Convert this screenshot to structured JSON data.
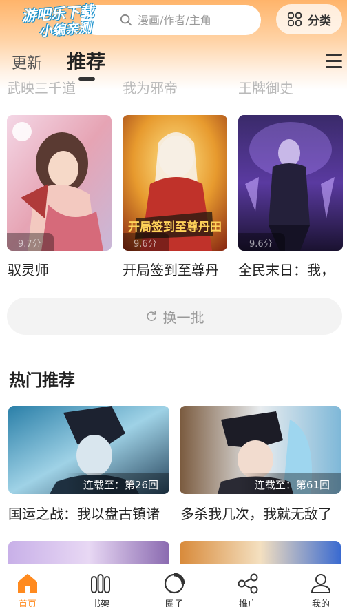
{
  "header": {
    "watermark_line1": "游吧乐下载",
    "watermark_line2": "小编亲测",
    "search_placeholder": "漫画/作者/主角",
    "category_label": "分类"
  },
  "tabs": [
    {
      "label": "更新",
      "active": false
    },
    {
      "label": "推荐",
      "active": true
    }
  ],
  "previous_row_titles": [
    "武映三千道",
    "我为邪帝",
    "王牌御史"
  ],
  "recommend_cards": [
    {
      "title": "驭灵师",
      "score": "9.7分"
    },
    {
      "title": "开局签到至尊丹",
      "score": "9.6分",
      "cover_text": "开局签到至尊丹田"
    },
    {
      "title": "全民末日：我，",
      "score": "9.6分"
    }
  ],
  "refresh_label": "换一批",
  "hot_section": {
    "title": "热门推荐",
    "cards": [
      {
        "title": "国运之战：我以盘古镇诸",
        "chapter": "连载至：第26回"
      },
      {
        "title": "多杀我几次，我就无敌了",
        "chapter": "连载至：第61回"
      }
    ]
  },
  "bottom_nav": [
    {
      "label": "首页",
      "icon": "home-icon",
      "active": true
    },
    {
      "label": "书架",
      "icon": "bookshelf-icon",
      "active": false
    },
    {
      "label": "圈子",
      "icon": "circle-icon",
      "active": false
    },
    {
      "label": "推广",
      "icon": "share-icon",
      "active": false
    },
    {
      "label": "我的",
      "icon": "user-icon",
      "active": false
    }
  ],
  "colors": {
    "accent": "#ff8a1f",
    "header_gradient_top": "#ffb46a"
  }
}
